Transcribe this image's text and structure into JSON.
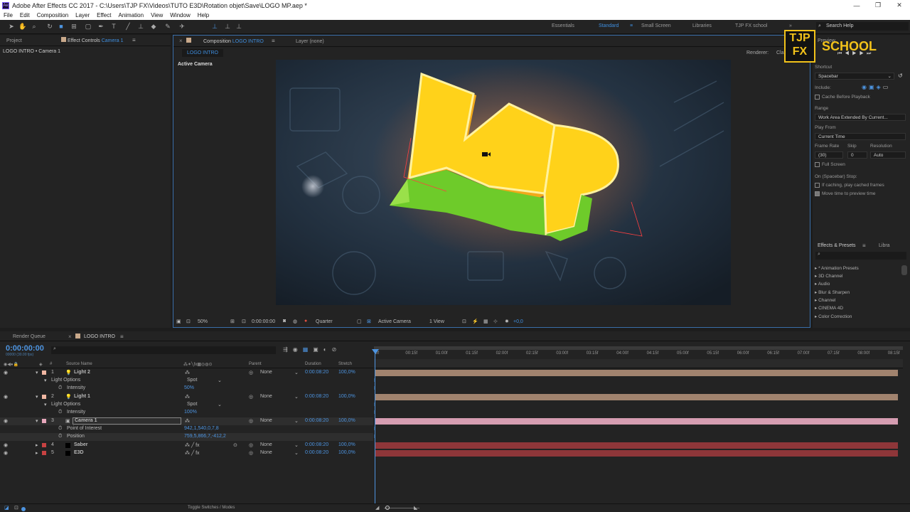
{
  "window": {
    "title": "Adobe After Effects CC 2017 - C:\\Users\\TJP FX\\Videos\\TUTO E3D\\Rotation objet\\Save\\LOGO MP.aep *"
  },
  "menu": [
    "File",
    "Edit",
    "Composition",
    "Layer",
    "Effect",
    "Animation",
    "View",
    "Window",
    "Help"
  ],
  "workspaces": [
    "Essentials",
    "Standard",
    "Small Screen",
    "Libraries",
    "TJP FX school"
  ],
  "search_help": "Search Help",
  "left_panel": {
    "tab_project": "Project",
    "tab_effect_controls": "Effect Controls",
    "tab_effect_target": "Camera 1",
    "path": "LOGO INTRO • Camera 1"
  },
  "comp_panel": {
    "tab": "Composition",
    "tab_name": "LOGO INTRO",
    "layer_tab": "Layer (none)",
    "sub_tab": "LOGO INTRO",
    "renderer_label": "Renderer:",
    "renderer_value": "Classic",
    "view_label": "Active Camera"
  },
  "viewer_footer": {
    "zoom": "50%",
    "timecode": "0:00:00:00",
    "quality": "Quarter",
    "camera": "Active Camera",
    "views": "1 View",
    "exposure": "+0,0"
  },
  "logo": {
    "line1": "TJP",
    "line2": "FX",
    "text": "SCHOOL"
  },
  "preview": {
    "title": "Preview",
    "shortcut_label": "Shortcut",
    "shortcut_value": "Spacebar",
    "include_label": "Include:",
    "cache_label": "Cache Before Playback",
    "range_label": "Range",
    "range_value": "Work Area Extended By Current...",
    "play_from_label": "Play From",
    "play_from_value": "Current Time",
    "frame_rate_label": "Frame Rate",
    "skip_label": "Skip",
    "resolution_label": "Resolution",
    "frame_rate_value": "(30)",
    "skip_value": "0",
    "resolution_value": "Auto",
    "full_screen_label": "Full Screen",
    "stop_label": "On (Spacebar) Stop:",
    "if_caching_label": "If caching, play cached frames",
    "move_time_label": "Move time to preview time"
  },
  "effects": {
    "tab": "Effects & Presets",
    "tab2": "Libra",
    "items": [
      "* Animation Presets",
      "3D Channel",
      "Audio",
      "Blur & Sharpen",
      "Channel",
      "CINEMA 4D",
      "Color Correction"
    ]
  },
  "timeline": {
    "tab_render": "Render Queue",
    "tab_comp": "LOGO INTRO",
    "timecode": "0:00:00:00",
    "fps": "00000 (30.00 fps)",
    "col_source": "Source Name",
    "col_parent": "Parent",
    "col_duration": "Duration",
    "col_stretch": "Stretch",
    "toggle_label": "Toggle Switches / Modes",
    "ruler": [
      "0f",
      "00:15f",
      "01:00f",
      "01:15f",
      "02:00f",
      "02:15f",
      "03:00f",
      "03:15f",
      "04:00f",
      "04:15f",
      "05:00f",
      "05:15f",
      "06:00f",
      "06:15f",
      "07:00f",
      "07:15f",
      "08:00f",
      "08:15f"
    ],
    "rows": [
      {
        "num": "1",
        "name": "Light 2",
        "parent": "None",
        "duration": "0:00:08:20",
        "stretch": "100,0%"
      },
      {
        "prop": "Light Options",
        "value": "Spot"
      },
      {
        "prop": "Intensity",
        "value": "50%"
      },
      {
        "num": "2",
        "name": "Light 1",
        "parent": "None",
        "duration": "0:00:08:20",
        "stretch": "100,0%"
      },
      {
        "prop": "Light Options",
        "value": "Spot"
      },
      {
        "prop": "Intensity",
        "value": "100%"
      },
      {
        "num": "3",
        "name": "Camera 1",
        "parent": "None",
        "duration": "0:00:08:20",
        "stretch": "100,0%"
      },
      {
        "prop": "Point of Interest",
        "value": "942,1,540,0,7,8"
      },
      {
        "prop": "Position",
        "value": "759,5,866,7,-412,2"
      },
      {
        "num": "4",
        "name": "Saber",
        "parent": "None",
        "duration": "0:00:08:20",
        "stretch": "100,0%"
      },
      {
        "num": "5",
        "name": "E3D",
        "parent": "None",
        "duration": "0:00:08:20",
        "stretch": "100,0%"
      }
    ]
  },
  "colors": {
    "accent": "#3f8fe0",
    "light_bar": "#a1836e",
    "camera_bar": "#d59db1",
    "layer_bar": "#8e3639"
  }
}
